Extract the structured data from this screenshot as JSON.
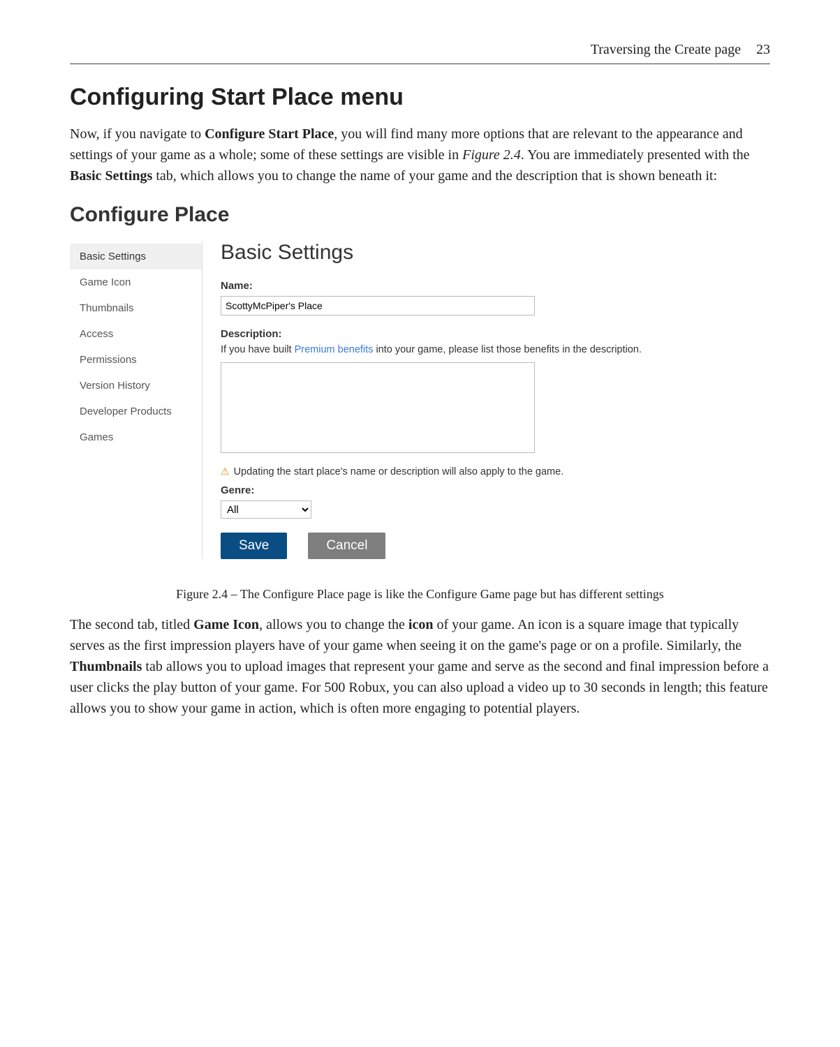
{
  "header": {
    "chapter": "Traversing the Create page",
    "page": "23"
  },
  "section_title": "Configuring Start Place menu",
  "para1": {
    "t1": "Now, if you navigate to ",
    "b1": "Configure Start Place",
    "t2": ", you will find many more options that are relevant to the appearance and settings of your game as a whole; some of these settings are visible in ",
    "i1": "Figure 2.4",
    "t3": ". You are immediately presented with the ",
    "b2": "Basic Settings",
    "t4": " tab, which allows you to change the name of your game and the description that is shown beneath it:"
  },
  "figure": {
    "title": "Configure Place",
    "sidebar": [
      "Basic Settings",
      "Game Icon",
      "Thumbnails",
      "Access",
      "Permissions",
      "Version History",
      "Developer Products",
      "Games"
    ],
    "main": {
      "heading": "Basic Settings",
      "name_label": "Name:",
      "name_value": "ScottyMcPiper's Place",
      "desc_label": "Description:",
      "desc_hint_pre": "If you have built ",
      "desc_hint_link": "Premium benefits",
      "desc_hint_post": " into your game, please list those benefits in the description.",
      "warning": "Updating the start place's name or description will also apply to the game.",
      "genre_label": "Genre:",
      "genre_value": "All",
      "save_label": "Save",
      "cancel_label": "Cancel"
    }
  },
  "caption": "Figure 2.4 – The Configure Place page is like the Configure Game page but has different settings",
  "para2": {
    "t1": "The second tab, titled ",
    "b1": "Game Icon",
    "t2": ", allows you to change the ",
    "b2": "icon",
    "t3": " of your game. An icon is a square image that typically serves as the first impression players have of your game when seeing it on the game's page or on a profile. Similarly, the ",
    "b3": "Thumbnails",
    "t4": " tab allows you to upload images that represent your game and serve as the second and final impression before a user clicks the play button of your game. For 500 Robux, you can also upload a video up to 30 seconds in length; this feature allows you to show your game in action, which is often more engaging to potential players."
  }
}
